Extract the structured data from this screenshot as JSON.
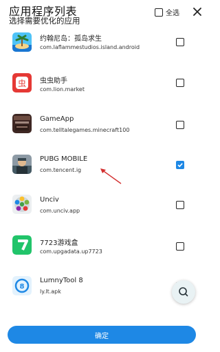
{
  "header": {
    "title": "应用程序列表",
    "subtitle": "选择需要优化的应用",
    "select_all_label": "全选"
  },
  "apps": [
    {
      "name": "约翰尼岛：孤岛求生",
      "package": "com.laflammestudios.island.android",
      "icon": "island-survival-icon",
      "checked": false
    },
    {
      "name": "虫虫助手",
      "package": "com.lion.market",
      "icon": "bug-assistant-icon",
      "checked": false
    },
    {
      "name": "GameApp",
      "package": "com.telltalegames.minecraft100",
      "icon": "minecraft-story-mode-icon",
      "checked": false
    },
    {
      "name": "PUBG MOBILE",
      "package": "com.tencent.ig",
      "icon": "pubg-mobile-icon",
      "checked": true
    },
    {
      "name": "Unciv",
      "package": "com.unciv.app",
      "icon": "unciv-icon",
      "checked": false
    },
    {
      "name": "7723游戏盒",
      "package": "com.upgadata.up7723",
      "icon": "7723-game-box-icon",
      "checked": false
    },
    {
      "name": "LumnyTool 8",
      "package": "ly.lt.apk",
      "icon": "lumnytool-icon",
      "checked": false
    }
  ],
  "confirm_label": "确定",
  "colors": {
    "accent": "#1e88e5",
    "arrow": "#d32f2f",
    "fab_bg": "#e9f2f4"
  }
}
